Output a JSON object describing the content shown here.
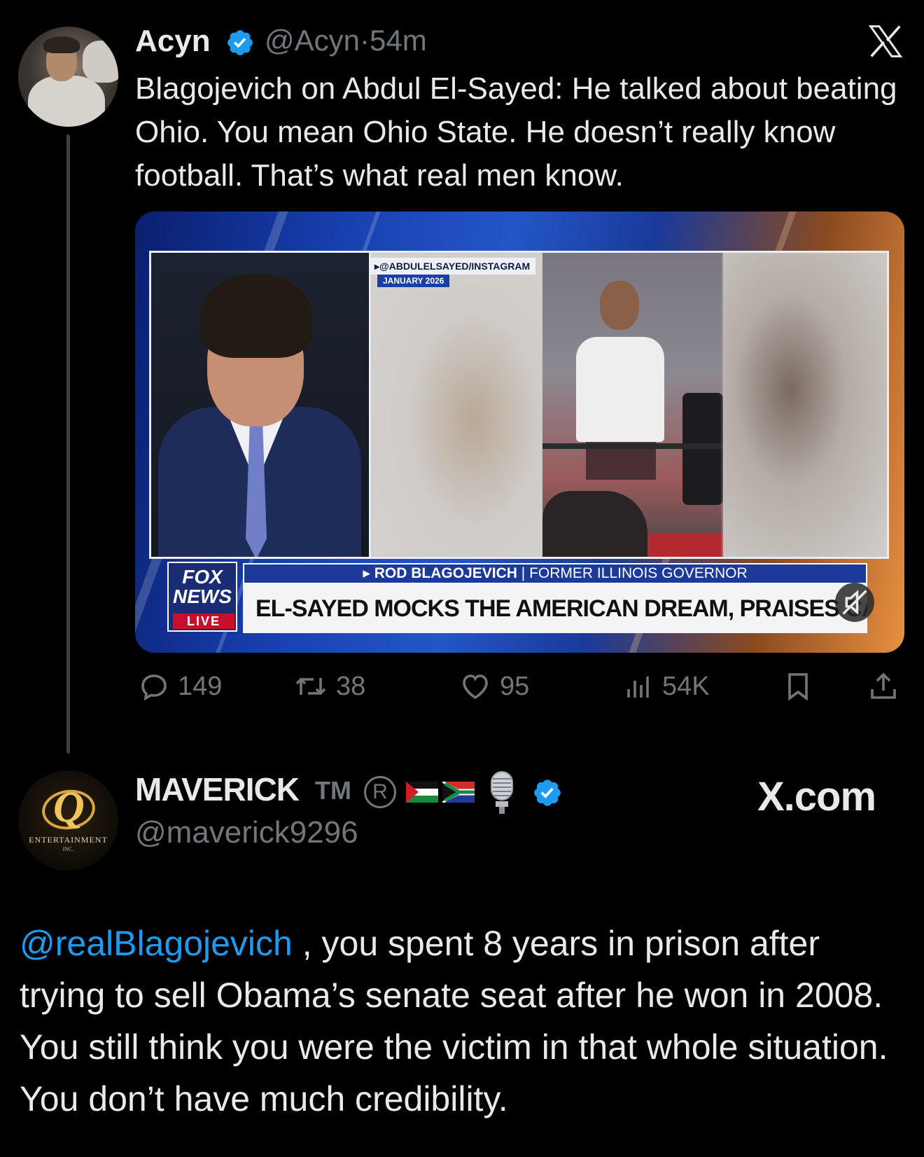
{
  "post": {
    "author_name": "Acyn",
    "verified": true,
    "handle": "@Acyn",
    "separator": "·",
    "time": "54m",
    "text": "Blagojevich on Abdul El-Sayed: He talked about beating Ohio. You mean Ohio State. He doesn’t really know football. That’s what real men know.",
    "media": {
      "source_tag": "@ABDULELSAYED/INSTAGRAM",
      "source_date": "JANUARY 2026",
      "network_logo_line1": "FOX",
      "network_logo_line2": "NEWS",
      "live_label": "LIVE",
      "chyron_name": "ROD BLAGOJEVICH",
      "chyron_divider": "|",
      "chyron_title": "FORMER ILLINOIS GOVERNOR",
      "headline": "EL-SAYED MOCKS THE AMERICAN DREAM, PRAISES CANADA",
      "mute_icon": "speaker-muted-icon"
    },
    "actions": {
      "replies": "149",
      "reposts": "38",
      "likes": "95",
      "views": "54K",
      "bookmark_icon": "bookmark-icon",
      "share_icon": "share-icon"
    }
  },
  "top_right_icon": "x-logo-icon",
  "reply": {
    "author_name": "MAVERICK",
    "trademark": "TM",
    "registered": "R",
    "flags": [
      "palestine-flag-icon",
      "south-africa-flag-icon"
    ],
    "mic_icon": "microphone-icon",
    "verified": true,
    "handle": "@maverick9296",
    "avatar_brand": "Q",
    "avatar_text": "ENTERTAINMENT",
    "avatar_subtext": "INC.",
    "watermark": "X.com",
    "mention": "@realBlagojevich",
    "text": " , you spent 8 years in prison after trying to sell Obama’s senate seat after he won in 2008. You still think you were the victim in that whole situation. You don’t have much credibility."
  },
  "colors": {
    "background": "#000000",
    "text_primary": "#e7e9ea",
    "text_secondary": "#71767b",
    "accent_blue": "#1d9bf0"
  }
}
